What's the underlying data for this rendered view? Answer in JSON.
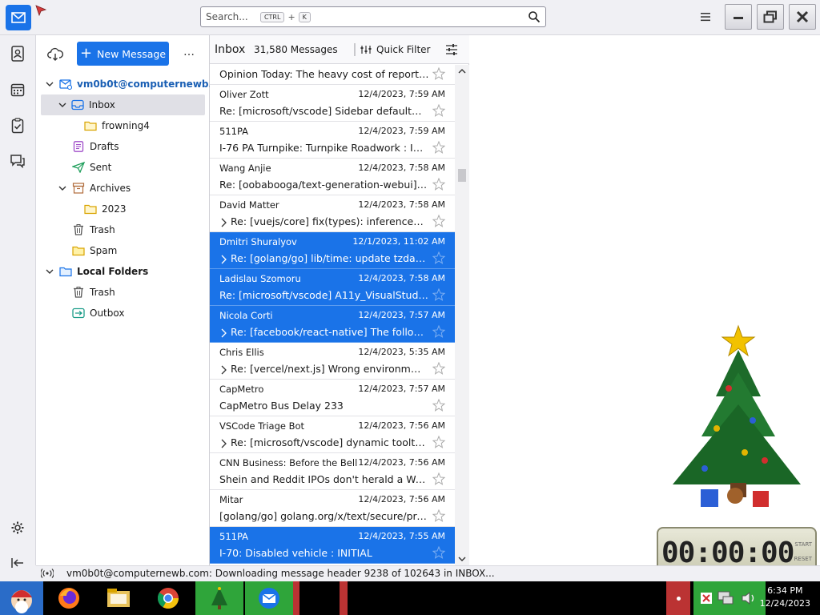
{
  "search": {
    "placeholder": "Search...",
    "key1": "CTRL",
    "plus": "+",
    "key2": "K"
  },
  "folder_pane": {
    "new_message": "New Message",
    "more": "…",
    "account": "vm0b0t@computernewb...",
    "folders": [
      {
        "label": "Inbox"
      },
      {
        "label": "frowning4"
      },
      {
        "label": "Drafts"
      },
      {
        "label": "Sent"
      },
      {
        "label": "Archives"
      },
      {
        "label": "2023"
      },
      {
        "label": "Trash"
      },
      {
        "label": "Spam"
      }
    ],
    "local_folders": "Local Folders",
    "local": [
      {
        "label": "Trash"
      },
      {
        "label": "Outbox"
      }
    ]
  },
  "thread_pane": {
    "title": "Inbox",
    "count": "31,580 Messages",
    "quick_filter": "Quick Filter",
    "messages": [
      {
        "from": "",
        "date": "",
        "subject": "Opinion Today: The heavy cost of reportin..."
      },
      {
        "from": "Oliver Zott",
        "date": "12/4/2023, 7:59 AM",
        "subject": "Re: [microsoft/vscode] Sidebar defaultWid..."
      },
      {
        "from": "511PA",
        "date": "12/4/2023, 7:59 AM",
        "subject": "I-76 PA Turnpike: Turnpike Roadwork : INITI..."
      },
      {
        "from": "Wang Anjie",
        "date": "12/4/2023, 7:58 AM",
        "subject": "Re: [oobabooga/text-generation-webui] A..."
      },
      {
        "from": "David Matter",
        "date": "12/4/2023, 7:58 AM",
        "subject": "Re: [vuejs/core] fix(types): inference for ..."
      },
      {
        "from": "Dmitri Shuralyov",
        "date": "12/1/2023, 11:02 AM",
        "subject": "Re: [golang/go] lib/time: update tzdata ..."
      },
      {
        "from": "Ladislau Szomoru",
        "date": "12/4/2023, 7:58 AM",
        "subject": "Re: [microsoft/vscode] A11y_VisualStudioC..."
      },
      {
        "from": "Nicola Corti",
        "date": "12/4/2023, 7:57 AM",
        "subject": "Re: [facebook/react-native] The followin..."
      },
      {
        "from": "Chris Ellis",
        "date": "12/4/2023, 5:35 AM",
        "subject": "Re: [vercel/next.js] Wrong environment v..."
      },
      {
        "from": "CapMetro",
        "date": "12/4/2023, 7:57 AM",
        "subject": "CapMetro Bus Delay 233"
      },
      {
        "from": "VSCode Triage Bot",
        "date": "12/4/2023, 7:56 AM",
        "subject": "Re: [microsoft/vscode] dynamic tooltip (..."
      },
      {
        "from": "CNN Business: Before the Bell",
        "date": "12/4/2023, 7:56 AM",
        "subject": "Shein and Reddit IPOs don't herald a Wall ..."
      },
      {
        "from": "Mitar",
        "date": "12/4/2023, 7:56 AM",
        "subject": "[golang/go] golang.org/x/text/secure/prec..."
      },
      {
        "from": "511PA",
        "date": "12/4/2023, 7:55 AM",
        "subject": "I-70: Disabled vehicle : INITIAL"
      }
    ]
  },
  "status": {
    "text": "vm0b0t@computernewb.com: Downloading message header 9238 of 102643 in INBOX..."
  },
  "taskbar": {
    "time": "6:34 PM",
    "date": "12/24/2023"
  },
  "clock": {
    "digits": "00:00:00",
    "start": "START",
    "reset": "RESET"
  },
  "colors": {
    "accent": "#1a73e8",
    "selected_row": "#1a73e8"
  }
}
